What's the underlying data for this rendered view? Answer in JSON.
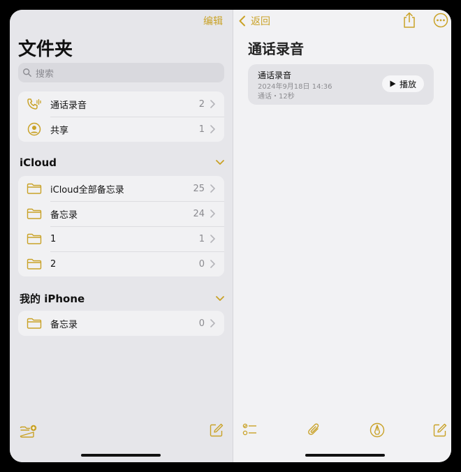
{
  "left": {
    "edit_label": "编辑",
    "title": "文件夹",
    "search": {
      "placeholder": "搜索"
    },
    "top_items": [
      {
        "label": "通话录音",
        "count": "2",
        "icon": "phone-waveform-icon"
      },
      {
        "label": "共享",
        "count": "1",
        "icon": "person-circle-icon"
      }
    ],
    "icloud": {
      "title": "iCloud",
      "items": [
        {
          "label": "iCloud全部备忘录",
          "count": "25",
          "icon": "folder-icon"
        },
        {
          "label": "备忘录",
          "count": "24",
          "icon": "folder-icon"
        },
        {
          "label": "1",
          "count": "1",
          "icon": "folder-icon"
        },
        {
          "label": "2",
          "count": "0",
          "icon": "folder-icon"
        }
      ]
    },
    "iphone": {
      "title": "我的 iPhone",
      "items": [
        {
          "label": "备忘录",
          "count": "0",
          "icon": "folder-icon"
        }
      ]
    }
  },
  "right": {
    "back_label": "返回",
    "title": "通话录音",
    "recording": {
      "name": "通话录音",
      "date": "2024年9月18日 14:36",
      "meta": "通话・12秒",
      "play_label": "播放"
    }
  },
  "colors": {
    "accent": "#c9a227",
    "left_bg": "#e6e6ea",
    "right_bg": "#f2f2f4"
  }
}
